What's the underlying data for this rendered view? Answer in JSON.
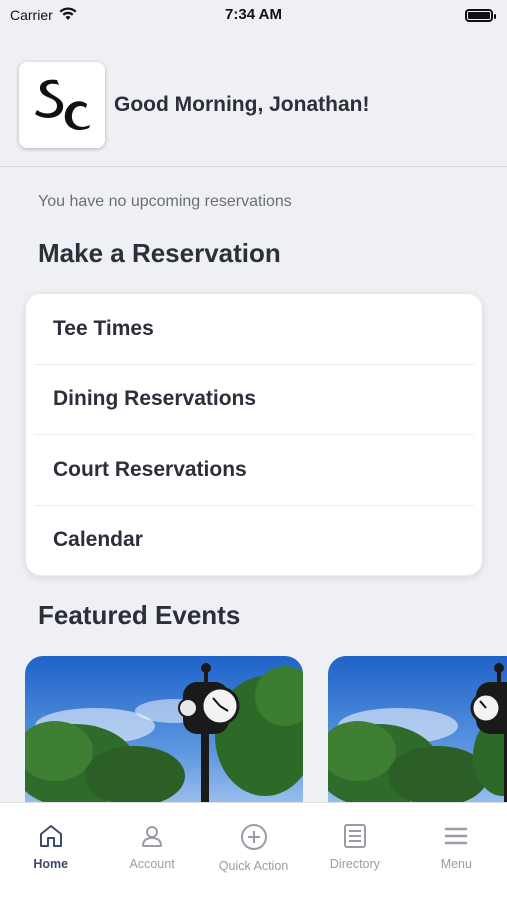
{
  "status_bar": {
    "carrier": "Carrier",
    "time": "7:34 AM"
  },
  "header": {
    "greeting": "Good Morning, Jonathan!",
    "logo_text": "SC"
  },
  "reservations_status": "You have no upcoming reservations",
  "make_reservation": {
    "title": "Make a Reservation",
    "items": [
      {
        "label": "Tee Times"
      },
      {
        "label": "Dining Reservations"
      },
      {
        "label": "Court Reservations"
      },
      {
        "label": "Calendar"
      }
    ]
  },
  "featured_events": {
    "title": "Featured Events"
  },
  "tab_bar": {
    "active": "Home",
    "tabs": [
      {
        "label": "Home",
        "icon": "home-icon"
      },
      {
        "label": "Account",
        "icon": "account-icon"
      },
      {
        "label": "Quick Action",
        "icon": "plus-circle-icon"
      },
      {
        "label": "Directory",
        "icon": "directory-icon"
      },
      {
        "label": "Menu",
        "icon": "menu-icon"
      }
    ]
  },
  "colors": {
    "background": "#eff0f4",
    "active_tab": "#3c4a6b",
    "inactive_tab": "#9a9ca5",
    "text": "#2c2f3a"
  }
}
